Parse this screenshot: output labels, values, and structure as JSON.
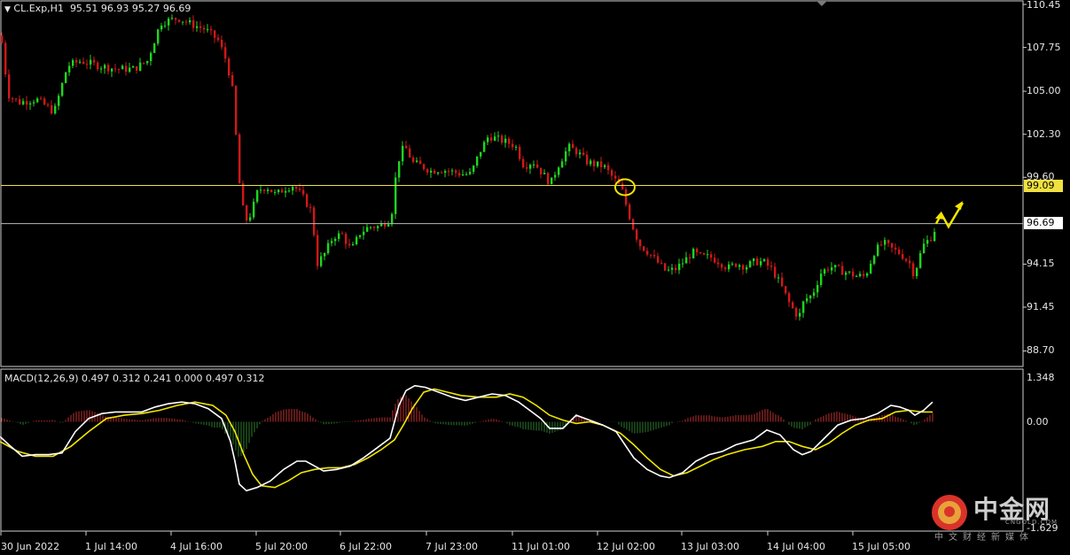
{
  "header": {
    "symbol": "CL.Exp,H1",
    "ohlc": "95.51 96.93 95.27 96.69"
  },
  "macd": {
    "label": "MACD(12,26,9) 0.497 0.312 0.241 0.000 0.497 0.312",
    "ticks": [
      "1.348",
      "0.00",
      "-1.629"
    ]
  },
  "price_axis": {
    "ticks": [
      "110.45",
      "107.75",
      "105.00",
      "102.30",
      "99.60",
      "94.15",
      "91.45",
      "88.70"
    ],
    "current_price_label": "96.69",
    "level_label": "99.09"
  },
  "time_axis": {
    "labels": [
      "30 Jun 2022",
      "1 Jul 14:00",
      "4 Jul 16:00",
      "5 Jul 20:00",
      "6 Jul 22:00",
      "7 Jul 23:00",
      "11 Jul 01:00",
      "12 Jul 02:00",
      "13 Jul 03:00",
      "14 Jul 04:00",
      "15 Jul 05:00"
    ]
  },
  "watermark": {
    "name": "中金网",
    "domain": "CNGOLD.COM",
    "tagline": "中文财经新媒体"
  },
  "colors": {
    "bull": "#1fd51f",
    "bear": "#d01818",
    "level_line": "#f0e040",
    "price_line": "#b8b8b8",
    "macd_main": "#ffffff",
    "macd_signal": "#f2e600",
    "hist_up": "#c03030",
    "hist_down": "#2e7d2e"
  },
  "chart_data": {
    "type": "candlestick",
    "symbol": "CL.Exp",
    "timeframe": "H1",
    "ylim": [
      87.5,
      110.8
    ],
    "horizontal_levels": [
      99.09,
      96.69
    ],
    "path_points": [
      [
        0,
        108.5
      ],
      [
        8,
        104.8
      ],
      [
        20,
        104.3
      ],
      [
        40,
        104.5
      ],
      [
        60,
        103.7
      ],
      [
        75,
        106.6
      ],
      [
        90,
        106.9
      ],
      [
        110,
        106.6
      ],
      [
        130,
        106.4
      ],
      [
        150,
        106.4
      ],
      [
        165,
        106.9
      ],
      [
        180,
        109.3
      ],
      [
        200,
        109.6
      ],
      [
        215,
        109.2
      ],
      [
        230,
        108.9
      ],
      [
        245,
        108.2
      ],
      [
        255,
        106.8
      ],
      [
        262,
        104.8
      ],
      [
        268,
        99.6
      ],
      [
        275,
        96.8
      ],
      [
        282,
        97.3
      ],
      [
        290,
        98.8
      ],
      [
        300,
        99.0
      ],
      [
        310,
        98.5
      ],
      [
        320,
        98.9
      ],
      [
        330,
        99.1
      ],
      [
        340,
        98.4
      ],
      [
        350,
        97.5
      ],
      [
        357,
        94.2
      ],
      [
        365,
        94.8
      ],
      [
        375,
        95.9
      ],
      [
        385,
        96.0
      ],
      [
        395,
        95.0
      ],
      [
        405,
        96.1
      ],
      [
        415,
        96.5
      ],
      [
        425,
        96.5
      ],
      [
        440,
        97.0
      ],
      [
        447,
        100.5
      ],
      [
        455,
        101.6
      ],
      [
        465,
        100.5
      ],
      [
        475,
        100.3
      ],
      [
        485,
        100.0
      ],
      [
        495,
        100.1
      ],
      [
        505,
        100.0
      ],
      [
        520,
        99.8
      ],
      [
        530,
        99.8
      ],
      [
        540,
        101.2
      ],
      [
        550,
        102.2
      ],
      [
        560,
        102.0
      ],
      [
        570,
        101.8
      ],
      [
        580,
        101.6
      ],
      [
        590,
        100.3
      ],
      [
        600,
        100.6
      ],
      [
        610,
        99.9
      ],
      [
        620,
        99.2
      ],
      [
        628,
        100.3
      ],
      [
        640,
        101.5
      ],
      [
        650,
        101.2
      ],
      [
        660,
        100.6
      ],
      [
        670,
        100.4
      ],
      [
        680,
        100.3
      ],
      [
        690,
        99.6
      ],
      [
        700,
        98.9
      ],
      [
        706,
        97.7
      ],
      [
        712,
        96.6
      ],
      [
        720,
        95.4
      ],
      [
        730,
        94.9
      ],
      [
        740,
        94.3
      ],
      [
        750,
        93.7
      ],
      [
        760,
        93.8
      ],
      [
        770,
        94.3
      ],
      [
        780,
        94.9
      ],
      [
        790,
        94.6
      ],
      [
        800,
        94.6
      ],
      [
        810,
        94.3
      ],
      [
        820,
        93.9
      ],
      [
        830,
        94.2
      ],
      [
        840,
        94.0
      ],
      [
        850,
        94.3
      ],
      [
        860,
        94.3
      ],
      [
        870,
        93.8
      ],
      [
        880,
        92.8
      ],
      [
        890,
        91.6
      ],
      [
        900,
        90.8
      ],
      [
        906,
        91.9
      ],
      [
        915,
        92.2
      ],
      [
        925,
        93.6
      ],
      [
        935,
        94.0
      ],
      [
        945,
        93.8
      ],
      [
        955,
        93.6
      ],
      [
        965,
        93.4
      ],
      [
        975,
        93.4
      ],
      [
        985,
        94.9
      ],
      [
        995,
        95.5
      ],
      [
        1005,
        95.1
      ],
      [
        1015,
        94.8
      ],
      [
        1025,
        94.2
      ],
      [
        1030,
        93.5
      ],
      [
        1040,
        95.3
      ],
      [
        1050,
        95.9
      ],
      [
        1056,
        96.69
      ]
    ],
    "macd_main": [
      [
        0,
        -0.45
      ],
      [
        10,
        -0.7
      ],
      [
        25,
        -1.05
      ],
      [
        40,
        -1.0
      ],
      [
        55,
        -1.0
      ],
      [
        70,
        -0.95
      ],
      [
        85,
        -0.3
      ],
      [
        100,
        0.1
      ],
      [
        115,
        0.25
      ],
      [
        130,
        0.3
      ],
      [
        145,
        0.3
      ],
      [
        160,
        0.3
      ],
      [
        175,
        0.45
      ],
      [
        190,
        0.55
      ],
      [
        205,
        0.6
      ],
      [
        220,
        0.55
      ],
      [
        235,
        0.4
      ],
      [
        250,
        0.1
      ],
      [
        260,
        -0.6
      ],
      [
        265,
        -1.2
      ],
      [
        270,
        -1.9
      ],
      [
        278,
        -2.1
      ],
      [
        290,
        -2.0
      ],
      [
        305,
        -1.8
      ],
      [
        320,
        -1.45
      ],
      [
        335,
        -1.2
      ],
      [
        345,
        -1.2
      ],
      [
        355,
        -1.35
      ],
      [
        365,
        -1.5
      ],
      [
        380,
        -1.45
      ],
      [
        395,
        -1.35
      ],
      [
        410,
        -1.1
      ],
      [
        425,
        -0.8
      ],
      [
        440,
        -0.5
      ],
      [
        450,
        0.5
      ],
      [
        458,
        0.95
      ],
      [
        468,
        1.1
      ],
      [
        480,
        1.05
      ],
      [
        495,
        0.9
      ],
      [
        510,
        0.75
      ],
      [
        525,
        0.65
      ],
      [
        540,
        0.75
      ],
      [
        555,
        0.85
      ],
      [
        570,
        0.8
      ],
      [
        585,
        0.6
      ],
      [
        600,
        0.3
      ],
      [
        610,
        0.1
      ],
      [
        620,
        -0.2
      ],
      [
        635,
        -0.2
      ],
      [
        650,
        0.2
      ],
      [
        665,
        0.05
      ],
      [
        680,
        -0.1
      ],
      [
        695,
        -0.3
      ],
      [
        705,
        -0.7
      ],
      [
        715,
        -1.1
      ],
      [
        730,
        -1.45
      ],
      [
        745,
        -1.65
      ],
      [
        755,
        -1.7
      ],
      [
        770,
        -1.55
      ],
      [
        785,
        -1.2
      ],
      [
        800,
        -1.0
      ],
      [
        815,
        -0.9
      ],
      [
        830,
        -0.7
      ],
      [
        850,
        -0.55
      ],
      [
        865,
        -0.25
      ],
      [
        880,
        -0.4
      ],
      [
        895,
        -0.85
      ],
      [
        905,
        -1.0
      ],
      [
        915,
        -0.9
      ],
      [
        930,
        -0.5
      ],
      [
        945,
        -0.1
      ],
      [
        960,
        0.05
      ],
      [
        975,
        0.1
      ],
      [
        990,
        0.25
      ],
      [
        1005,
        0.5
      ],
      [
        1015,
        0.45
      ],
      [
        1025,
        0.35
      ],
      [
        1032,
        0.2
      ],
      [
        1042,
        0.35
      ],
      [
        1052,
        0.6
      ]
    ],
    "macd_signal": [
      [
        0,
        -0.6
      ],
      [
        20,
        -0.9
      ],
      [
        40,
        -1.05
      ],
      [
        60,
        -1.05
      ],
      [
        80,
        -0.75
      ],
      [
        100,
        -0.3
      ],
      [
        120,
        0.1
      ],
      [
        140,
        0.2
      ],
      [
        160,
        0.25
      ],
      [
        180,
        0.35
      ],
      [
        200,
        0.5
      ],
      [
        220,
        0.6
      ],
      [
        240,
        0.5
      ],
      [
        255,
        0.2
      ],
      [
        265,
        -0.3
      ],
      [
        275,
        -1.0
      ],
      [
        285,
        -1.6
      ],
      [
        295,
        -1.95
      ],
      [
        310,
        -2.0
      ],
      [
        325,
        -1.8
      ],
      [
        340,
        -1.55
      ],
      [
        355,
        -1.45
      ],
      [
        370,
        -1.4
      ],
      [
        385,
        -1.4
      ],
      [
        400,
        -1.3
      ],
      [
        415,
        -1.1
      ],
      [
        430,
        -0.85
      ],
      [
        445,
        -0.55
      ],
      [
        455,
        -0.1
      ],
      [
        465,
        0.4
      ],
      [
        478,
        0.9
      ],
      [
        490,
        1.0
      ],
      [
        505,
        0.9
      ],
      [
        520,
        0.8
      ],
      [
        540,
        0.75
      ],
      [
        560,
        0.75
      ],
      [
        575,
        0.85
      ],
      [
        590,
        0.75
      ],
      [
        605,
        0.5
      ],
      [
        620,
        0.2
      ],
      [
        635,
        0.05
      ],
      [
        650,
        -0.05
      ],
      [
        665,
        0.0
      ],
      [
        680,
        -0.1
      ],
      [
        700,
        -0.35
      ],
      [
        715,
        -0.7
      ],
      [
        730,
        -1.1
      ],
      [
        745,
        -1.45
      ],
      [
        760,
        -1.65
      ],
      [
        775,
        -1.55
      ],
      [
        790,
        -1.35
      ],
      [
        805,
        -1.15
      ],
      [
        820,
        -1.0
      ],
      [
        840,
        -0.85
      ],
      [
        860,
        -0.75
      ],
      [
        875,
        -0.6
      ],
      [
        890,
        -0.6
      ],
      [
        905,
        -0.75
      ],
      [
        920,
        -0.85
      ],
      [
        935,
        -0.65
      ],
      [
        950,
        -0.35
      ],
      [
        965,
        -0.1
      ],
      [
        980,
        0.05
      ],
      [
        995,
        0.1
      ],
      [
        1010,
        0.3
      ],
      [
        1025,
        0.35
      ],
      [
        1040,
        0.3
      ],
      [
        1052,
        0.3
      ]
    ],
    "annotations": [
      {
        "type": "circle",
        "x": 705,
        "y": 99.09
      },
      {
        "type": "forecast_arrow",
        "points": [
          [
            1056,
            96.69
          ],
          [
            1062,
            97.3
          ],
          [
            1070,
            96.5
          ],
          [
            1086,
            98.0
          ]
        ]
      }
    ]
  }
}
